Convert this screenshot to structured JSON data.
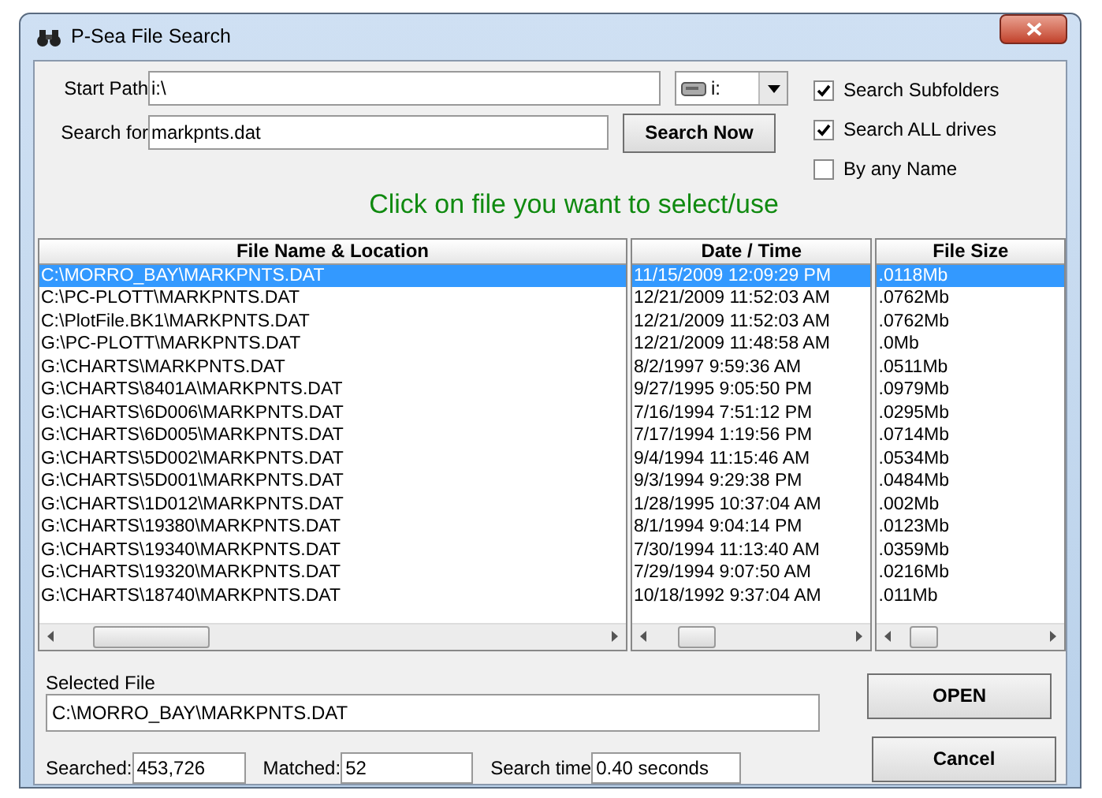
{
  "window": {
    "title": "P-Sea File Search"
  },
  "start_path": {
    "label": "Start Path",
    "value": "i:\\"
  },
  "drive": {
    "value": "i:"
  },
  "search_for": {
    "label": "Search for",
    "value": "markpnts.dat"
  },
  "search_button": "Search Now",
  "options": [
    {
      "label": "Search Subfolders",
      "checked": true
    },
    {
      "label": "Search ALL drives",
      "checked": true
    },
    {
      "label": "By any Name",
      "checked": false
    }
  ],
  "instruction": "Click on file you want to select/use",
  "columns": [
    "File Name & Location",
    "Date / Time",
    "File Size"
  ],
  "files": [
    {
      "name": "C:\\MORRO_BAY\\MARKPNTS.DAT",
      "datetime": "11/15/2009 12:09:29 PM",
      "size": ".0118Mb",
      "selected": true
    },
    {
      "name": "C:\\PC-PLOTT\\MARKPNTS.DAT",
      "datetime": "12/21/2009 11:52:03 AM",
      "size": ".0762Mb",
      "selected": false
    },
    {
      "name": "C:\\PlotFile.BK1\\MARKPNTS.DAT",
      "datetime": "12/21/2009 11:52:03 AM",
      "size": ".0762Mb",
      "selected": false
    },
    {
      "name": "G:\\PC-PLOTT\\MARKPNTS.DAT",
      "datetime": "12/21/2009 11:48:58 AM",
      "size": ".0Mb",
      "selected": false
    },
    {
      "name": "G:\\CHARTS\\MARKPNTS.DAT",
      "datetime": "8/2/1997 9:59:36 AM",
      "size": ".0511Mb",
      "selected": false
    },
    {
      "name": "G:\\CHARTS\\8401A\\MARKPNTS.DAT",
      "datetime": "9/27/1995 9:05:50 PM",
      "size": ".0979Mb",
      "selected": false
    },
    {
      "name": "G:\\CHARTS\\6D006\\MARKPNTS.DAT",
      "datetime": "7/16/1994 7:51:12 PM",
      "size": ".0295Mb",
      "selected": false
    },
    {
      "name": "G:\\CHARTS\\6D005\\MARKPNTS.DAT",
      "datetime": "7/17/1994 1:19:56 PM",
      "size": ".0714Mb",
      "selected": false
    },
    {
      "name": "G:\\CHARTS\\5D002\\MARKPNTS.DAT",
      "datetime": "9/4/1994 11:15:46 AM",
      "size": ".0534Mb",
      "selected": false
    },
    {
      "name": "G:\\CHARTS\\5D001\\MARKPNTS.DAT",
      "datetime": "9/3/1994 9:29:38 PM",
      "size": ".0484Mb",
      "selected": false
    },
    {
      "name": "G:\\CHARTS\\1D012\\MARKPNTS.DAT",
      "datetime": "1/28/1995 10:37:04 AM",
      "size": ".002Mb",
      "selected": false
    },
    {
      "name": "G:\\CHARTS\\19380\\MARKPNTS.DAT",
      "datetime": "8/1/1994 9:04:14 PM",
      "size": ".0123Mb",
      "selected": false
    },
    {
      "name": "G:\\CHARTS\\19340\\MARKPNTS.DAT",
      "datetime": "7/30/1994 11:13:40 AM",
      "size": ".0359Mb",
      "selected": false
    },
    {
      "name": "G:\\CHARTS\\19320\\MARKPNTS.DAT",
      "datetime": "7/29/1994 9:07:50 AM",
      "size": ".0216Mb",
      "selected": false
    },
    {
      "name": "G:\\CHARTS\\18740\\MARKPNTS.DAT",
      "datetime": "10/18/1992 9:37:04 AM",
      "size": ".011Mb",
      "selected": false
    }
  ],
  "selected_file": {
    "label": "Selected File",
    "value": "C:\\MORRO_BAY\\MARKPNTS.DAT"
  },
  "open_button": "OPEN",
  "cancel_button": "Cancel",
  "stats": [
    {
      "label": "Searched:",
      "value": "453,726"
    },
    {
      "label": "Matched:",
      "value": "52"
    },
    {
      "label": "Search time",
      "value": "0.40  seconds"
    }
  ]
}
